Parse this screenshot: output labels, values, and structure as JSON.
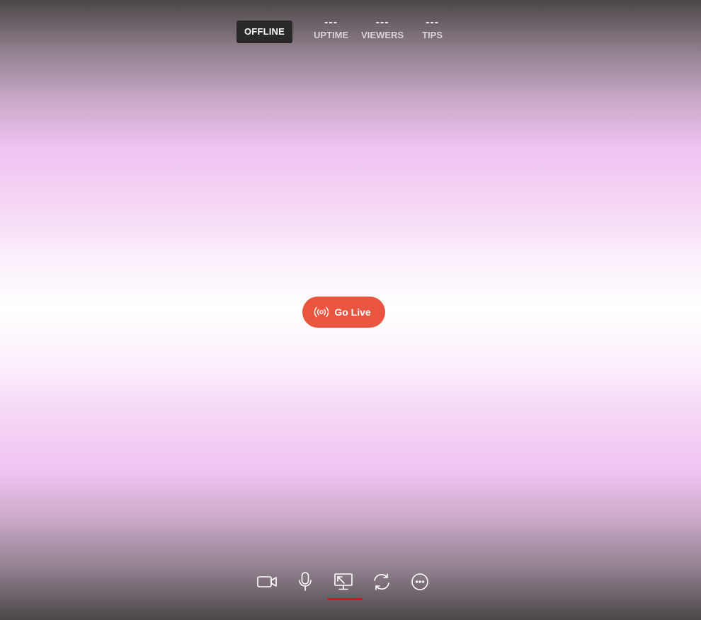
{
  "status": {
    "badge": "OFFLINE",
    "stats": [
      {
        "value": "---",
        "label": "UPTIME"
      },
      {
        "value": "---",
        "label": "VIEWERS"
      },
      {
        "value": "---",
        "label": "TIPS"
      }
    ]
  },
  "go_live": {
    "label": "Go Live",
    "icon": "broadcast-icon",
    "color": "#e9553f"
  },
  "toolbar": {
    "items": [
      {
        "name": "camera",
        "icon": "video-camera-icon"
      },
      {
        "name": "microphone",
        "icon": "microphone-icon"
      },
      {
        "name": "screen-share",
        "icon": "screen-share-icon",
        "active": true
      },
      {
        "name": "switch",
        "icon": "refresh-icon"
      },
      {
        "name": "more",
        "icon": "more-options-icon"
      }
    ],
    "active_indicator_color": "#d8131b"
  }
}
